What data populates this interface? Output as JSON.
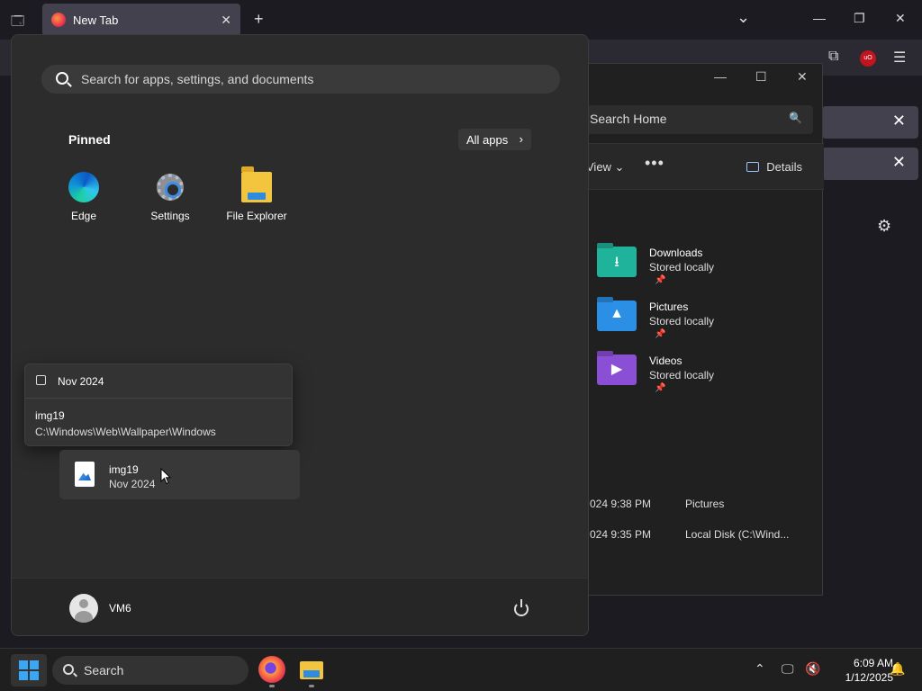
{
  "browser": {
    "tab_title": "New Tab",
    "tab_close": "✕",
    "new_tab": "+",
    "list_all": "⌄",
    "win_min": "—",
    "win_max": "❐",
    "win_close": "✕",
    "ublock_badge": "uO",
    "banner_close": "✕"
  },
  "explorer": {
    "search_placeholder": "Search Home",
    "view_label": "View ⌄",
    "more": "•••",
    "details_label": "Details",
    "items": [
      {
        "name": "Downloads",
        "sub": "Stored locally",
        "color": "#1fb39b"
      },
      {
        "name": "Pictures",
        "sub": "Stored locally",
        "color": "#2b8fe6"
      },
      {
        "name": "Videos",
        "sub": "Stored locally",
        "color": "#8b4fd6"
      }
    ],
    "rows": [
      {
        "date": "024 9:38 PM",
        "location": "Pictures"
      },
      {
        "date": "024 9:35 PM",
        "location": "Local Disk (C:\\Wind..."
      }
    ]
  },
  "start": {
    "search_placeholder": "Search for apps, settings, and documents",
    "pinned_label": "Pinned",
    "all_apps_label": "All apps",
    "apps": [
      {
        "label": "Edge"
      },
      {
        "label": "Settings"
      },
      {
        "label": "File Explorer"
      }
    ],
    "popup": {
      "header": "Nov 2024",
      "name": "img19",
      "path": "C:\\Windows\\Web\\Wallpaper\\Windows"
    },
    "recent": {
      "name": "img19",
      "date": "Nov 2024"
    },
    "user": "VM6"
  },
  "taskbar": {
    "search_label": "Search",
    "time": "6:09 AM",
    "date": "1/12/2025"
  },
  "colors": {
    "accent": "#3aa6f5",
    "start_bg": "#2c2c2c"
  }
}
